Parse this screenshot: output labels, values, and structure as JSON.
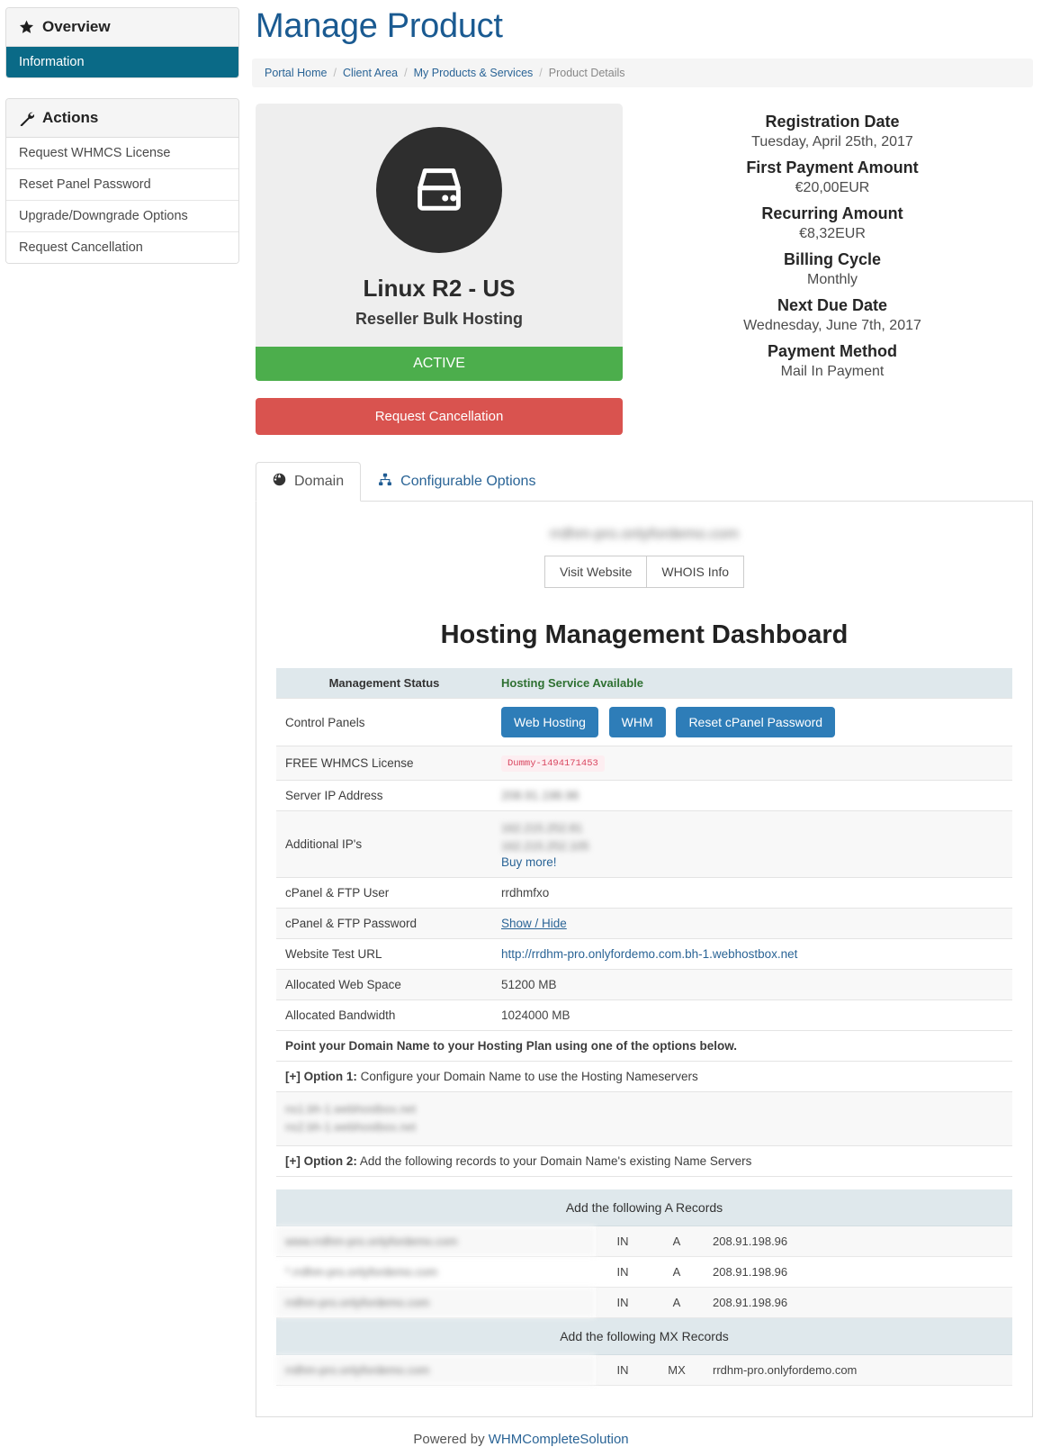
{
  "sidebar": {
    "overview": {
      "title": "Overview",
      "icon": "star-icon",
      "items": [
        {
          "label": "Information",
          "active": true
        }
      ]
    },
    "actions": {
      "title": "Actions",
      "icon": "wrench-icon",
      "items": [
        {
          "label": "Request WHMCS License"
        },
        {
          "label": "Reset Panel Password"
        },
        {
          "label": "Upgrade/Downgrade Options"
        },
        {
          "label": "Request Cancellation"
        }
      ]
    }
  },
  "header": {
    "title": "Manage Product",
    "breadcrumb": [
      {
        "label": "Portal Home",
        "current": false
      },
      {
        "label": "Client Area",
        "current": false
      },
      {
        "label": "My Products & Services",
        "current": false
      },
      {
        "label": "Product Details",
        "current": true
      }
    ],
    "separator": "/"
  },
  "product": {
    "icon": "server-icon",
    "name": "Linux R2 - US",
    "group": "Reseller Bulk Hosting",
    "status": "ACTIVE",
    "status_color": "#4cae4c",
    "cancel_button": "Request Cancellation",
    "cancel_color": "#d9534f"
  },
  "billing": [
    {
      "label": "Registration Date",
      "value": "Tuesday, April 25th, 2017"
    },
    {
      "label": "First Payment Amount",
      "value": "€20,00EUR"
    },
    {
      "label": "Recurring Amount",
      "value": "€8,32EUR"
    },
    {
      "label": "Billing Cycle",
      "value": "Monthly"
    },
    {
      "label": "Next Due Date",
      "value": "Wednesday, June 7th, 2017"
    },
    {
      "label": "Payment Method",
      "value": "Mail In Payment"
    }
  ],
  "tabs": [
    {
      "label": "Domain",
      "icon": "globe-icon",
      "active": true
    },
    {
      "label": "Configurable Options",
      "icon": "sitemap-icon",
      "active": false
    }
  ],
  "domain": {
    "name": "rrdhm-pro.onlyfordemo.com",
    "visit_button": "Visit Website",
    "whois_button": "WHOIS Info"
  },
  "dashboard": {
    "title": "Hosting Management Dashboard",
    "header": {
      "left": "Management Status",
      "status": "Hosting Service Available",
      "status_color": "#2e7031"
    },
    "control_panels": {
      "label": "Control Panels",
      "buttons": [
        "Web Hosting",
        "WHM",
        "Reset cPanel Password"
      ],
      "button_color": "#2e7db8"
    },
    "rows": [
      {
        "label": "FREE WHMCS License",
        "value": "Dummy-1494171453",
        "kind": "badge"
      },
      {
        "label": "Server IP Address",
        "value": "208.91.198.96",
        "kind": "blurred"
      },
      {
        "label": "Additional IP's",
        "value": "162.215.252.81\n162.215.252.105",
        "kind": "blurred-multi",
        "extra_link": "Buy more!"
      },
      {
        "label": "cPanel & FTP User",
        "value": "rrdhmfxo",
        "kind": "text"
      },
      {
        "label": "cPanel & FTP Password",
        "value": "Show / Hide",
        "kind": "link-underline"
      },
      {
        "label": "Website Test URL",
        "value": "http://rrdhm-pro.onlyfordemo.com.bh-1.webhostbox.net",
        "kind": "link"
      },
      {
        "label": "Allocated Web Space",
        "value": "51200 MB",
        "kind": "text"
      },
      {
        "label": "Allocated Bandwidth",
        "value": "1024000 MB",
        "kind": "text"
      }
    ],
    "point_note": "Point your Domain Name to your Hosting Plan using one of the options below.",
    "option1": {
      "prefix": "[+] Option 1:",
      "text": " Configure your Domain Name to use the Hosting Nameservers"
    },
    "nameservers": [
      "ns1.bh-1.webhostbox.net",
      "ns2.bh-1.webhostbox.net"
    ],
    "option2": {
      "prefix": "[+] Option 2:",
      "text": " Add the following records to your Domain Name's existing Name Servers"
    },
    "a_records": {
      "title": "Add the following A Records",
      "rows": [
        {
          "host": "www.rrdhm-pro.onlyfordemo.com",
          "class": "IN",
          "type": "A",
          "dest": "208.91.198.96"
        },
        {
          "host": "*.rrdhm-pro.onlyfordemo.com",
          "class": "IN",
          "type": "A",
          "dest": "208.91.198.96"
        },
        {
          "host": "rrdhm-pro.onlyfordemo.com",
          "class": "IN",
          "type": "A",
          "dest": "208.91.198.96"
        }
      ]
    },
    "mx_records": {
      "title": "Add the following MX Records",
      "rows": [
        {
          "host": "rrdhm-pro.onlyfordemo.com",
          "class": "IN",
          "type": "MX",
          "dest": "rrdhm-pro.onlyfordemo.com"
        }
      ]
    }
  },
  "footer": {
    "prefix": "Powered by ",
    "link": "WHMCompleteSolution"
  }
}
